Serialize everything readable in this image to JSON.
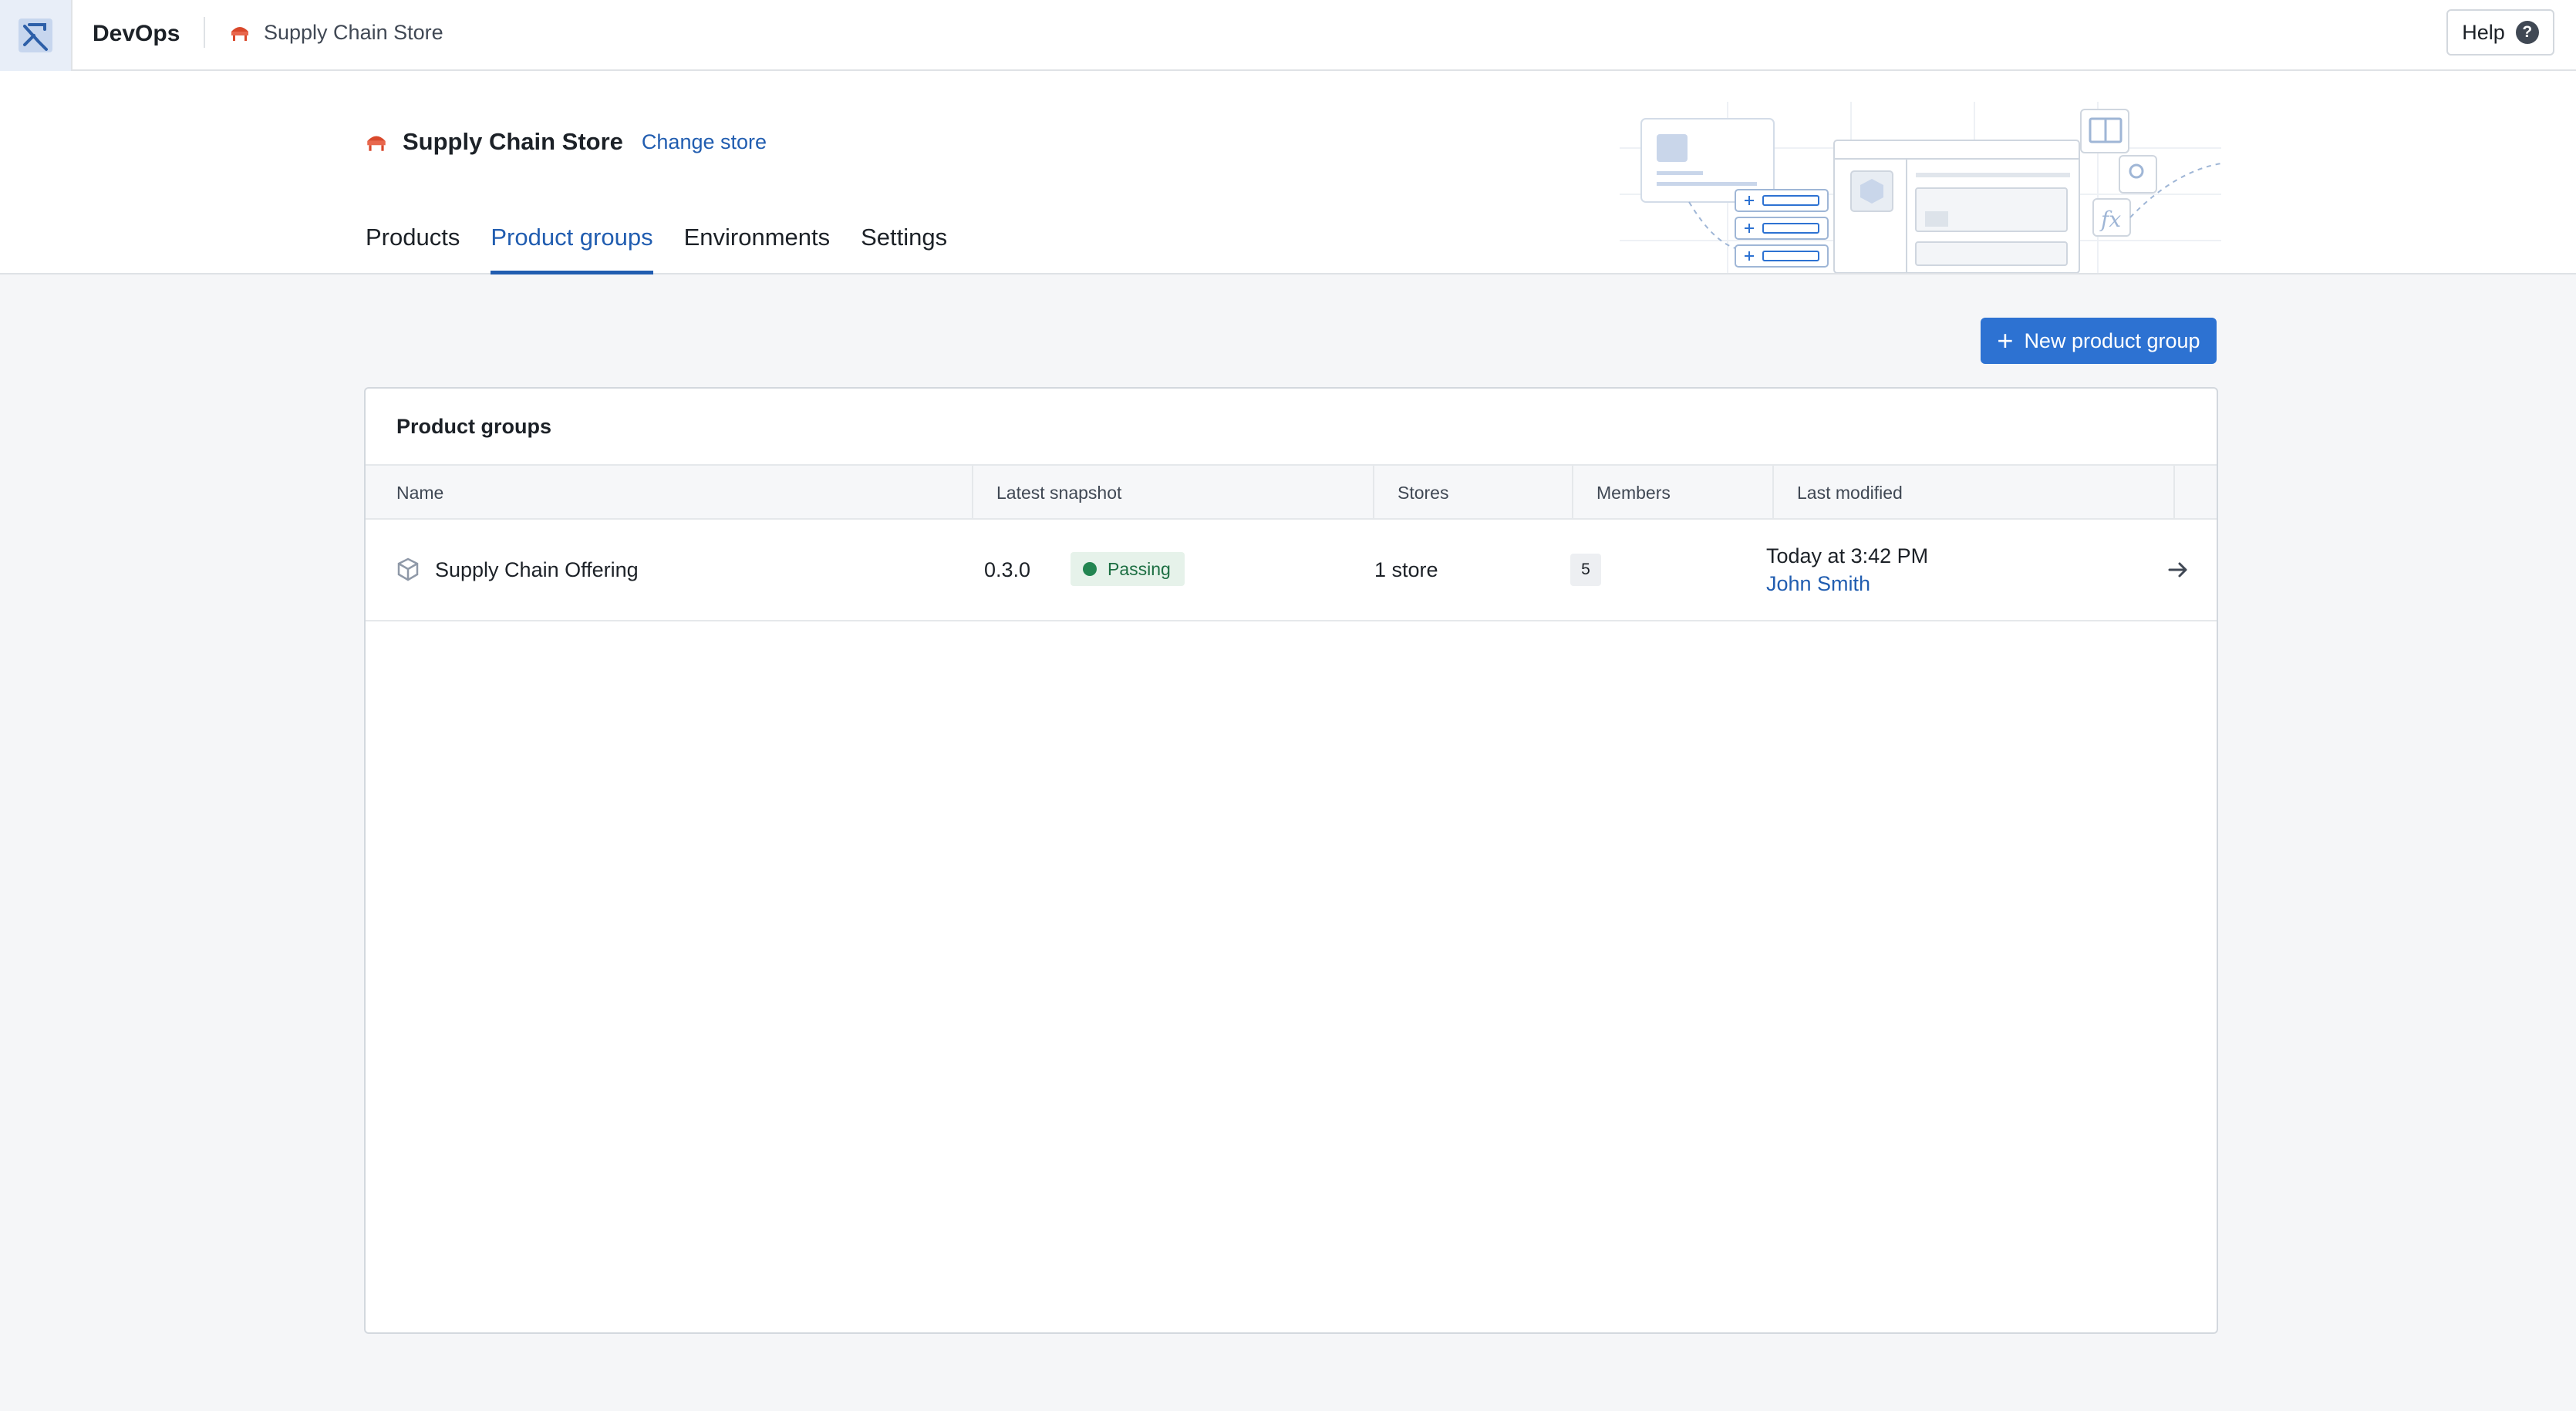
{
  "topbar": {
    "app_name": "DevOps",
    "app_icon": "devops-logo-icon",
    "breadcrumb_store": "Supply Chain Store",
    "breadcrumb_icon": "store-icon",
    "help_label": "Help",
    "help_icon": "question-circle-icon"
  },
  "header": {
    "store_name": "Supply Chain Store",
    "change_store_label": "Change store",
    "tabs": [
      {
        "label": "Products",
        "active": false
      },
      {
        "label": "Product groups",
        "active": true
      },
      {
        "label": "Environments",
        "active": false
      },
      {
        "label": "Settings",
        "active": false
      }
    ]
  },
  "actions": {
    "new_product_group_label": "New product group"
  },
  "table": {
    "title": "Product groups",
    "columns": [
      "Name",
      "Latest snapshot",
      "Stores",
      "Members",
      "Last modified"
    ],
    "rows": [
      {
        "name": "Supply Chain Offering",
        "icon": "product-group-icon",
        "version": "0.3.0",
        "status": "Passing",
        "stores": "1 store",
        "members": "5",
        "modified_time": "Today at 3:42 PM",
        "modified_by": "John Smith"
      }
    ]
  },
  "colors": {
    "accent": "#2d72d2",
    "link": "#215db0",
    "success": "#238551",
    "store_icon": "#d9482b"
  }
}
